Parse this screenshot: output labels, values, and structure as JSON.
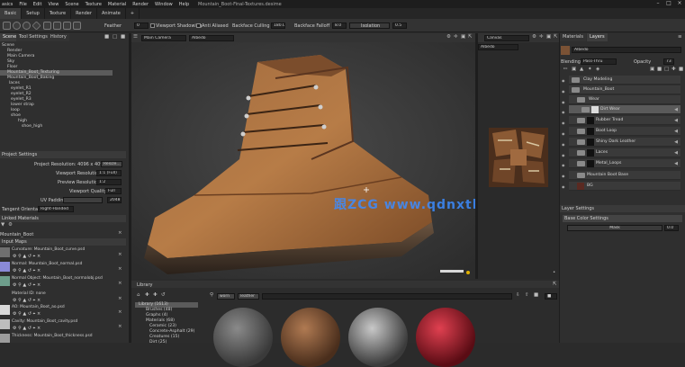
{
  "titlebar": {
    "menus": [
      "asics",
      "File",
      "Edit",
      "View",
      "Scene",
      "Texture",
      "Material",
      "Render",
      "Window",
      "Help"
    ],
    "title": "Mountain_Boot-Final-Textures.desime"
  },
  "modebar": {
    "tabs": [
      "Basic",
      "Setup",
      "Texture",
      "Render",
      "Animate",
      "+"
    ],
    "active": 0
  },
  "toolbar": {
    "feather_label": "Feather",
    "feather_value": "0",
    "viewport_shadowing": "Viewport Shadowing",
    "anti_aliased": "Anti Aliased",
    "backface_culling_label": "Backface Culling",
    "backface_culling_value": "180.0",
    "backface_falloff_label": "Backface Falloff",
    "backface_falloff_value": "8.0",
    "isolation_label": "Isolation",
    "isolation_value": "0.5"
  },
  "left": {
    "tabs": [
      "Scene",
      "Tool Settings",
      "History"
    ],
    "tree": [
      "Scene",
      "Render",
      "Main Camera",
      "Sky",
      "Floor",
      "Mountain_Boot_Texturing",
      "Mountain_Boot_Baking",
      "laces",
      "eyelet_R1",
      "eyelet_R2",
      "eyelet_R3",
      "lower strap",
      "loop",
      "shoe",
      "high",
      "shoe_high"
    ],
    "project_settings_header": "Project Settings",
    "project_resolution_label": "Project Resolution: 4096 x 4096",
    "resize_button": "Resize...",
    "viewport_resolution_label": "Viewport Resolution:",
    "viewport_resolution_value": "1:1 (Full)",
    "preview_resolution_label": "Preview Resolution:",
    "preview_resolution_value": "1:2",
    "viewport_quality_label": "Viewport Quality:",
    "viewport_quality_value": "Full",
    "uv_padding_label": "UV Padding",
    "uv_padding_value": "2048",
    "tangent_orientation_label": "Tangent Orientation:",
    "tangent_orientation_value": "Right-Handed",
    "linked_materials_header": "Linked Materials",
    "linked_material_name": "Mountain_Boot",
    "input_maps_header": "Input Maps",
    "input_maps": [
      "Curvature: Mountain_Boot_curve.psd",
      "Normal: Mountain_Boot_normal.psd",
      "Normal Object: Mountain_Boot_normalobj.psd",
      "Material ID: none",
      "AO: Mountain_Boot_ao.psd",
      "Cavity: Mountain_Boot_cavity.psd",
      "Thickness: Mountain_Boot_thickness.psd"
    ]
  },
  "viewport": {
    "camera": "Main Camera",
    "channel": "Albedo",
    "watermark": "跟ZCG www.qdnxtb.cn"
  },
  "uvpanel": {
    "camera": "Canvas",
    "channel": "Albedo"
  },
  "right": {
    "tabs": [
      "Materials",
      "Layers"
    ],
    "channel": "Albedo",
    "blending_label": "Blending",
    "blending_value": "Pass-Thru",
    "opacity_label": "Opacity",
    "opacity_value": "73",
    "layers": [
      {
        "name": "Clay Modeling",
        "kind": "folder",
        "indent": 0
      },
      {
        "name": "Mountain_Boot",
        "kind": "folder",
        "indent": 0
      },
      {
        "name": "Wear",
        "kind": "folder",
        "indent": 1
      },
      {
        "name": "Dirt Wear",
        "kind": "thumb",
        "indent": 2
      },
      {
        "name": "Rubber Tread",
        "kind": "thumb",
        "indent": 1
      },
      {
        "name": "Boot Loop",
        "kind": "thumb",
        "indent": 1
      },
      {
        "name": "Shiny Dark Leather",
        "kind": "thumb",
        "indent": 1
      },
      {
        "name": "Laces",
        "kind": "thumb",
        "indent": 1
      },
      {
        "name": "Metal_Loops",
        "kind": "thumb",
        "indent": 1
      },
      {
        "name": "Mountain Boot Base",
        "kind": "folder",
        "indent": 1
      },
      {
        "name": "BG",
        "kind": "thumb",
        "indent": 1
      }
    ],
    "selected_layer": 3,
    "layer_settings_header": "Layer Settings",
    "base_color_settings": "Base Color Settings",
    "mask_label": "Mask",
    "mask_value": "0.0"
  },
  "library": {
    "header": "Library",
    "search_tags": [
      "worn",
      "leather"
    ],
    "tree": [
      "Library (1613)",
      "Brushes (48)",
      "Graphs (4)",
      "Materials (68)",
      "Ceramic (23)",
      "Concrete-Asphalt (29)",
      "Creatures (15)",
      "Dirt (25)"
    ]
  }
}
